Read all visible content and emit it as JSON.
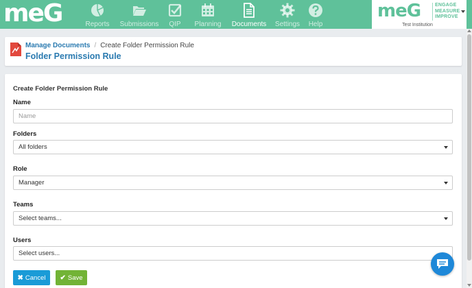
{
  "app": {
    "logo_text": "meG"
  },
  "nav": [
    {
      "label": "Reports",
      "icon": "pie-chart-icon",
      "active": false
    },
    {
      "label": "Submissions",
      "icon": "folder-open-icon",
      "active": false
    },
    {
      "label": "QIP",
      "icon": "checkbox-icon",
      "active": false
    },
    {
      "label": "Planning",
      "icon": "calendar-icon",
      "active": false
    },
    {
      "label": "Documents",
      "icon": "document-icon",
      "active": true
    },
    {
      "label": "Settings",
      "icon": "gear-icon",
      "active": false
    },
    {
      "label": "Help",
      "icon": "question-icon",
      "active": false
    }
  ],
  "brand": {
    "logo_text": "meG",
    "tagline": [
      "ENGAGE",
      "MEASURE",
      "IMPROVE"
    ],
    "institution": "Test Institution"
  },
  "breadcrumb": {
    "parent": "Manage Documents",
    "current": "Create Folder Permission Rule"
  },
  "page_title": "Folder Permission Rule",
  "form": {
    "section_title": "Create Folder Permission Rule",
    "name": {
      "label": "Name",
      "placeholder": "Name",
      "value": ""
    },
    "folders": {
      "label": "Folders",
      "value": "All folders"
    },
    "role": {
      "label": "Role",
      "value": "Manager"
    },
    "teams": {
      "label": "Teams",
      "value": "Select teams..."
    },
    "users": {
      "label": "Users",
      "value": "Select users..."
    },
    "cancel_label": "Cancel",
    "save_label": "Save"
  },
  "colors": {
    "topbar": "#5fc19a",
    "link": "#2a7ab0",
    "cancel": "#1a9bd7",
    "save": "#72b336",
    "chat": "#1e88d8"
  }
}
